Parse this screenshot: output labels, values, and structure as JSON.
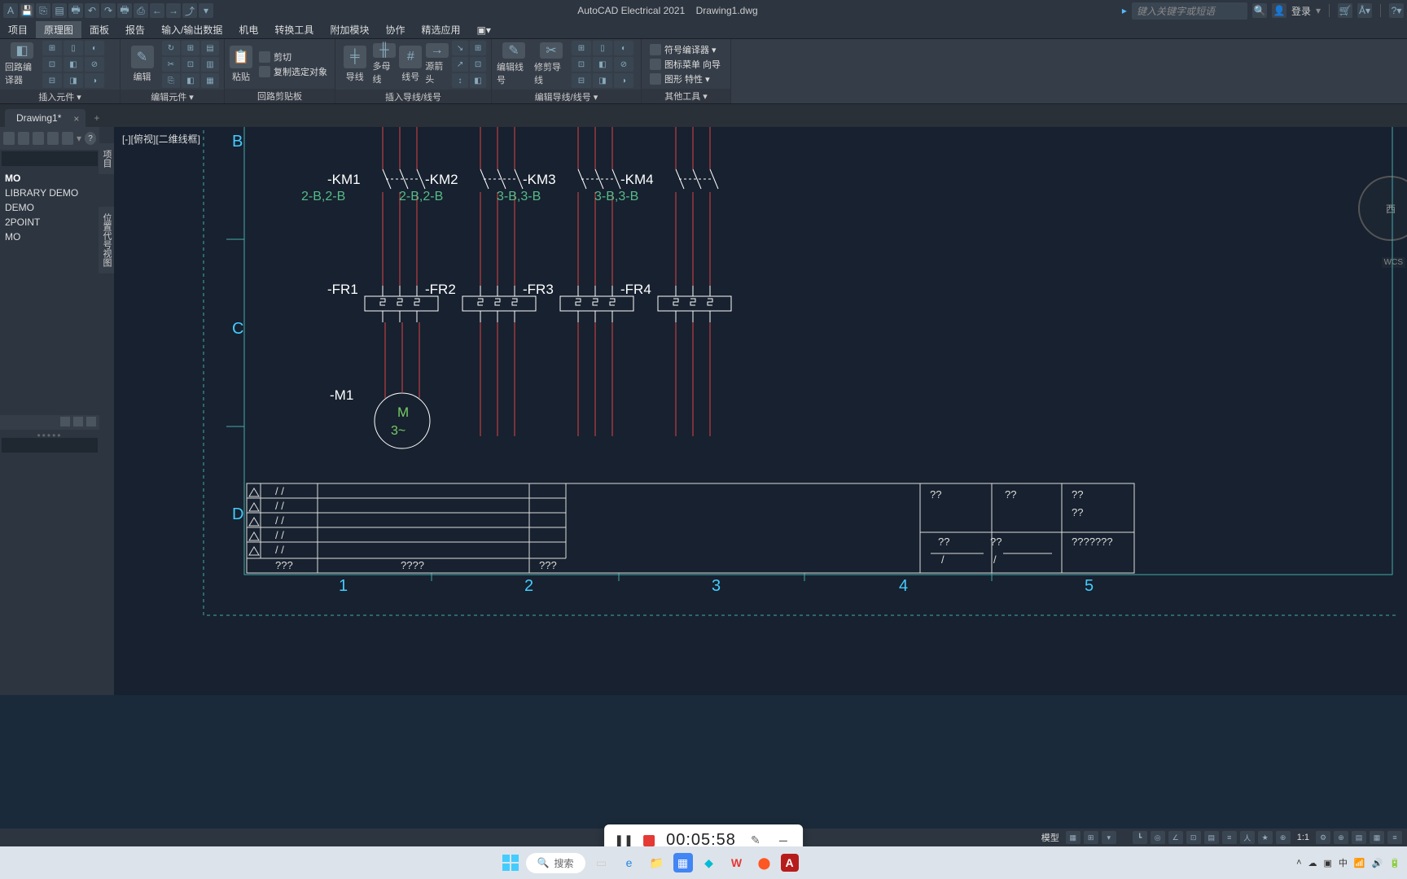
{
  "titlebar": {
    "app": "AutoCAD Electrical 2021",
    "file": "Drawing1.dwg",
    "search_placeholder": "键入关键字或短语",
    "login": "登录"
  },
  "menu": {
    "items": [
      "项目",
      "原理图",
      "面板",
      "报告",
      "输入/输出数据",
      "机电",
      "转换工具",
      "附加模块",
      "协作",
      "精选应用"
    ],
    "active_index": 1
  },
  "ribbon": {
    "panels": [
      {
        "label": "插入元件 ▾",
        "big": [
          {
            "icon": "◧",
            "text": "回路编译器"
          }
        ],
        "grid": 9
      },
      {
        "label": "编辑元件 ▾",
        "big": [
          {
            "icon": "✎",
            "text": "编辑"
          }
        ],
        "grid": 12,
        "extra_row": 3
      },
      {
        "label": "回路剪贴板",
        "big": [
          {
            "icon": "📋",
            "text": "粘贴"
          }
        ],
        "rows": [
          "剪切",
          "复制选定对象"
        ]
      },
      {
        "label": "插入导线/线号",
        "big": [
          {
            "icon": "╪",
            "text": "导线"
          },
          {
            "icon": "╫",
            "text": "多母线"
          },
          {
            "icon": "#",
            "text": "线号"
          },
          {
            "icon": "→",
            "text": "源箭头"
          }
        ],
        "grid": 6
      },
      {
        "label": "编辑导线/线号 ▾",
        "big": [
          {
            "icon": "✎",
            "text": "编辑线号"
          },
          {
            "icon": "✂",
            "text": "修剪导线"
          }
        ],
        "grid": 9
      },
      {
        "label": "其他工具 ▾",
        "rows": [
          "符号编译器 ▾",
          "图标菜单 向导",
          "图形 特性 ▾"
        ]
      }
    ]
  },
  "tabs": {
    "file": "Drawing1*"
  },
  "sidebar": {
    "items": [
      {
        "label": "MO",
        "hd": true
      },
      {
        "label": "LIBRARY DEMO"
      },
      {
        "label": "DEMO"
      },
      {
        "label": "2POINT"
      },
      {
        "label": "MO"
      }
    ]
  },
  "vtabs": [
    "项目",
    "位置代号视图"
  ],
  "canvas": {
    "view_label": "[-][俯视][二维线框]",
    "rows": [
      "B",
      "C",
      "D"
    ],
    "cols": [
      "1",
      "2",
      "3",
      "4",
      "5"
    ],
    "km": [
      {
        "tag": "-KM1",
        "xref": "2-B,2-B"
      },
      {
        "tag": "-KM2",
        "xref": "2-B,2-B"
      },
      {
        "tag": "-KM3",
        "xref": "3-B,3-B"
      },
      {
        "tag": "-KM4",
        "xref": "3-B,3-B"
      }
    ],
    "fr": [
      "-FR1",
      "-FR2",
      "-FR3",
      "-FR4"
    ],
    "motor": {
      "tag": "-M1",
      "text1": "M",
      "text2": "3~"
    },
    "titleblock": {
      "cell_slash": "/   /",
      "q3": "???",
      "q4": "????",
      "q3b": "???",
      "r1": "??",
      "r2": "??",
      "r3": "??",
      "r4": "??",
      "r5": "??",
      "r6": "??",
      "r7": "???????",
      "slash": "/"
    },
    "compass": "西",
    "wcs": "WCS"
  },
  "recorder": {
    "time": "00:05:58"
  },
  "status": {
    "model": "模型",
    "ratio": "1:1"
  },
  "taskbar": {
    "search": "搜索"
  }
}
